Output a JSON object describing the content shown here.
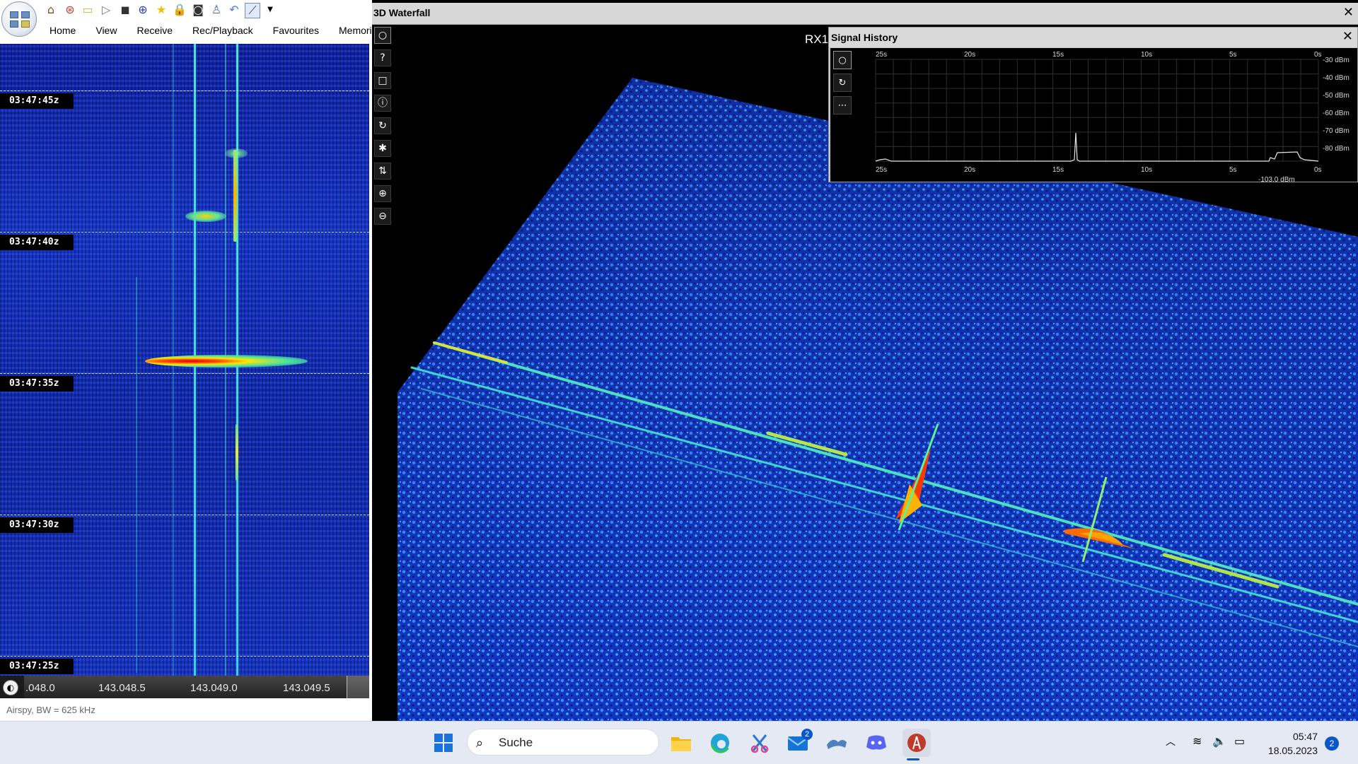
{
  "quick_access": {
    "icons": [
      "home-icon",
      "lifebuoy-icon",
      "folder-icon",
      "play-icon",
      "stop-icon",
      "plus-circle-icon",
      "star-icon",
      "lock-icon",
      "camera-icon",
      "user-icon",
      "undo-icon",
      "chart-icon",
      "dropdown-arrow-icon"
    ]
  },
  "menu": {
    "items": [
      {
        "label": "Home"
      },
      {
        "label": "View"
      },
      {
        "label": "Receive"
      },
      {
        "label": "Rec/Playback"
      },
      {
        "label": "Favourites"
      },
      {
        "label": "Memorie"
      }
    ]
  },
  "waterfall2d": {
    "timestamps": [
      "03:47:45z",
      "03:47:40z",
      "03:47:35z",
      "03:47:30z",
      "03:47:25z"
    ]
  },
  "frequency_scale": {
    "labels": [
      ".048.0",
      "143.048.5",
      "143.049.0",
      "143.049.5"
    ]
  },
  "status": {
    "text": "Airspy, BW = 625 kHz"
  },
  "waterfall3d": {
    "title": "3D Waterfall",
    "receiver_label": "RX1",
    "toolbar": [
      "circle-icon",
      "help-icon",
      "square-icon",
      "info-icon",
      "refresh-icon",
      "star-burst-icon",
      "swap-vertical-icon",
      "zoom-in-icon",
      "zoom-out-icon"
    ]
  },
  "signal_history": {
    "title": "Signal History",
    "time_ticks": [
      "25s",
      "20s",
      "15s",
      "10s",
      "5s",
      "0s"
    ],
    "level_ticks": [
      "-30 dBm",
      "-40 dBm",
      "-50 dBm",
      "-60 dBm",
      "-70 dBm",
      "-80 dBm"
    ],
    "partial_readout": "-103.0 dBm",
    "tools": [
      "circle-icon",
      "refresh-icon",
      "more-icon"
    ]
  },
  "taskbar": {
    "search_placeholder": "Suche",
    "mail_badge": "2",
    "apps": [
      "file-explorer-icon",
      "edge-icon",
      "snipping-tool-icon",
      "mail-icon",
      "weather-icon",
      "discord-icon",
      "sdr-app-icon"
    ]
  },
  "clock": {
    "time": "05:47",
    "date": "18.05.2023"
  },
  "notification_count": "2"
}
